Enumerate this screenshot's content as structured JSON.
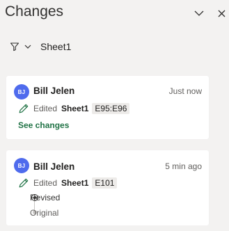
{
  "pane": {
    "title": "Changes",
    "collapse_icon": "chevron-down-icon",
    "close_icon": "close-icon"
  },
  "filter": {
    "icon": "filter-icon",
    "dropdown_icon": "chevron-down-icon",
    "label": "Sheet1"
  },
  "cards": [
    {
      "avatar_initials": "BJ",
      "avatar_color": "#4f6bed",
      "author": "Bill Jelen",
      "time": "Just now",
      "action": "Edited",
      "sheet": "Sheet1",
      "range": "E95:E96",
      "link": "See changes"
    },
    {
      "avatar_initials": "BJ",
      "avatar_color": "#4f6bed",
      "author": "Bill Jelen",
      "time": "5 min ago",
      "action": "Edited",
      "sheet": "Sheet1",
      "range": "E101",
      "versions": [
        {
          "label": "Revised",
          "selected": true
        },
        {
          "label": "Original",
          "selected": false
        }
      ]
    }
  ],
  "colors": {
    "background": "#f3f2f1",
    "card": "#ffffff",
    "accent_green": "#217346",
    "avatar": "#4f6bed"
  }
}
